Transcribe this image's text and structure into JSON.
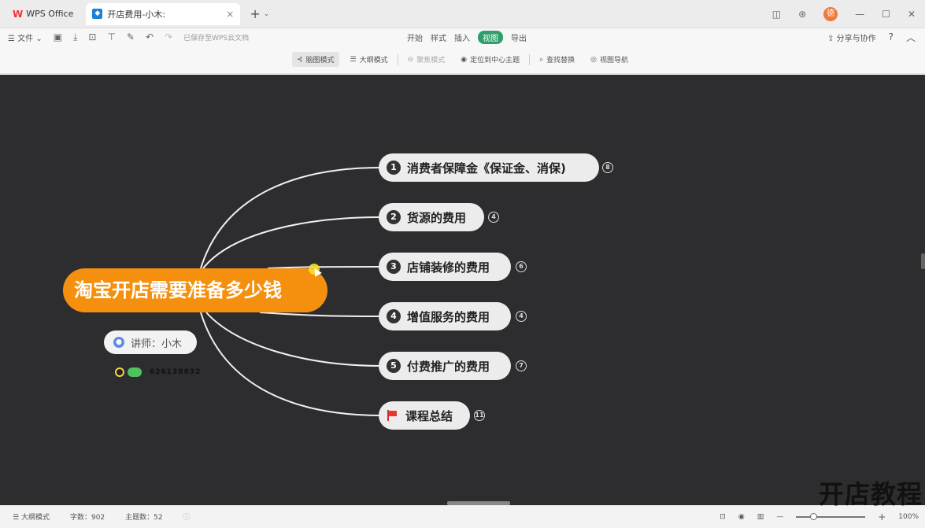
{
  "titlebar": {
    "app_tab": "WPS Office",
    "doc_tab": "开店费用-小木:",
    "close": "×",
    "add": "+",
    "dropdown": "⌄",
    "avatar_text": "德"
  },
  "menubar": {
    "file_label": "文件",
    "saved_text": "已保存至WPS云文档",
    "items": [
      "开始",
      "样式",
      "插入",
      "视图",
      "导出"
    ],
    "share_label": "分享与协作",
    "help": "?"
  },
  "toolbar": {
    "mindmap_mode": "脑图模式",
    "outline_mode": "大纲模式",
    "focus_mode": "聚焦模式",
    "locate_center": "定位到中心主题",
    "find_replace": "查找替换",
    "view_nav": "视图导航"
  },
  "mindmap": {
    "root": "淘宝开店需要准备多少钱",
    "lecturer": "讲师：小木",
    "contact_number": "626138632",
    "topics": [
      {
        "num": "1",
        "label": "消费者保障金《保证金、消保)",
        "count": "8"
      },
      {
        "num": "2",
        "label": "货源的费用",
        "count": "4"
      },
      {
        "num": "3",
        "label": "店铺装修的费用",
        "count": "6"
      },
      {
        "num": "4",
        "label": "增值服务的费用",
        "count": "4"
      },
      {
        "num": "5",
        "label": "付费推广的费用",
        "count": "7"
      },
      {
        "num": "",
        "label": "课程总结",
        "count": "11"
      }
    ]
  },
  "statusbar": {
    "outline_mode": "大纲模式",
    "word_count": "字数：902",
    "topic_count": "主题数：52",
    "zoom_minus": "—",
    "zoom_plus": "+",
    "zoom_value": "100%"
  },
  "watermark": "开店教程",
  "colors": {
    "root": "#f5900f",
    "canvas": "#2d2d30",
    "topic": "#ececec",
    "accent": "#2e9e6a"
  }
}
